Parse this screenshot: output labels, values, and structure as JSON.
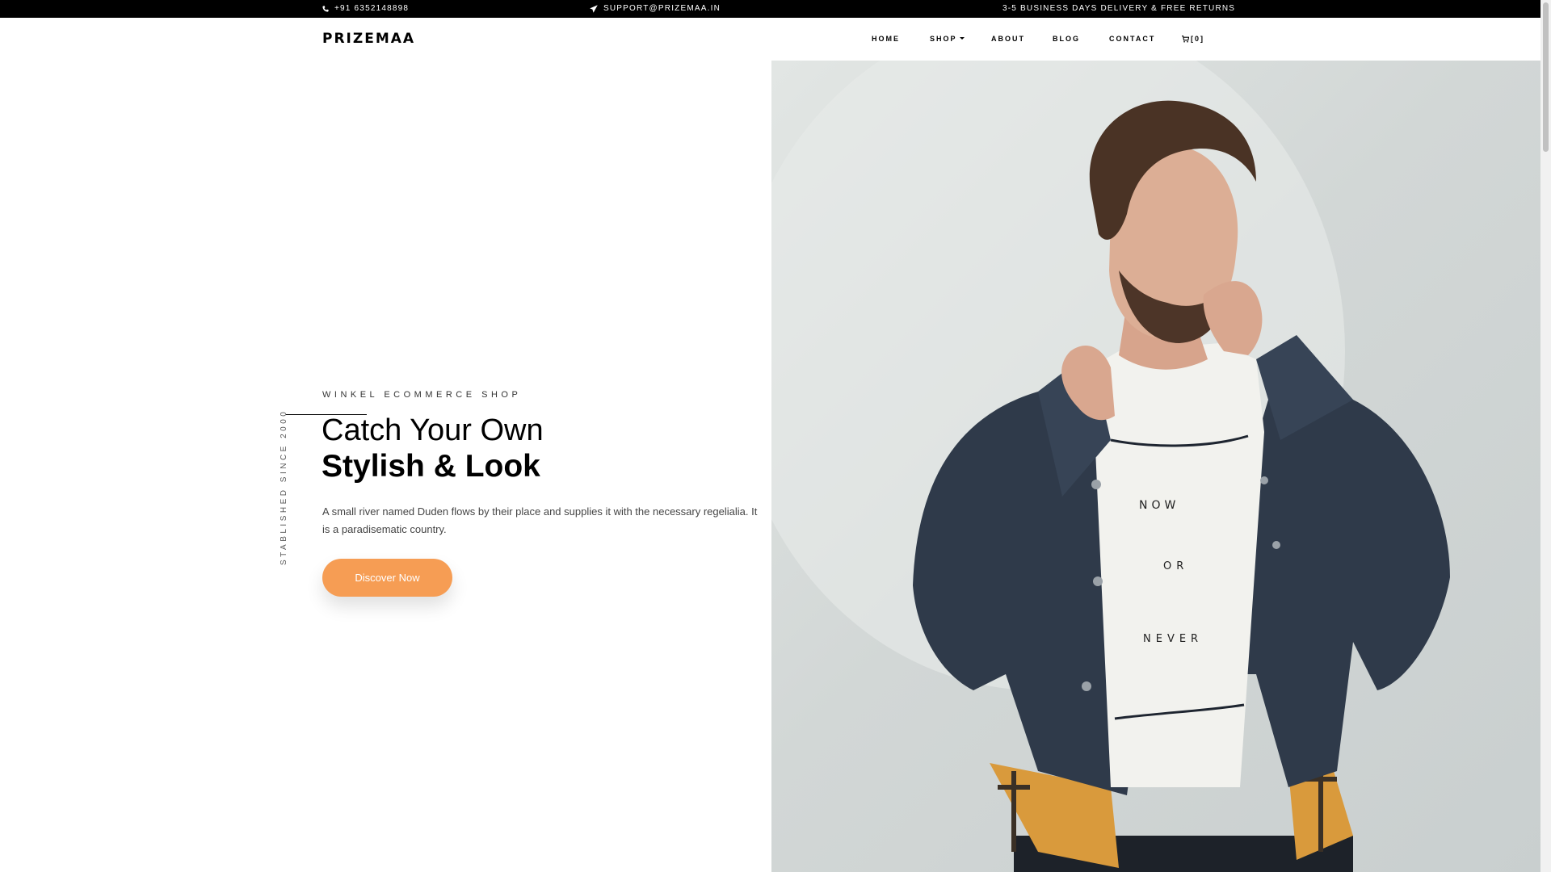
{
  "topbar": {
    "phone": "+91 6352148898",
    "email": "SUPPORT@PRIZEMAA.IN",
    "delivery": "3-5 BUSINESS DAYS DELIVERY & FREE RETURNS",
    "phone_icon": "phone-icon",
    "email_icon": "paper-plane-icon"
  },
  "header": {
    "logo": "PRIZEMAA",
    "nav": {
      "home": "HOME",
      "shop": "SHOP",
      "about": "ABOUT",
      "blog": "BLOG",
      "contact": "CONTACT",
      "cart": "[0]",
      "cart_icon": "cart-icon"
    }
  },
  "hero": {
    "eyebrow": "WINKEL ECOMMERCE SHOP",
    "vertical_label": "STABLISHED SINCE 2000",
    "title_light": "Catch Your Own",
    "title_bold": "Stylish & Look",
    "description": "A small river named Duden flows by their place and supplies it with the necessary regelialia. It is a paradisematic country.",
    "cta": "Discover Now",
    "photo_shirt_text": [
      "NOW",
      "OR",
      "NEVER"
    ]
  },
  "colors": {
    "accent": "#f69d54",
    "topbar_bg": "#000000",
    "text": "#000000"
  }
}
